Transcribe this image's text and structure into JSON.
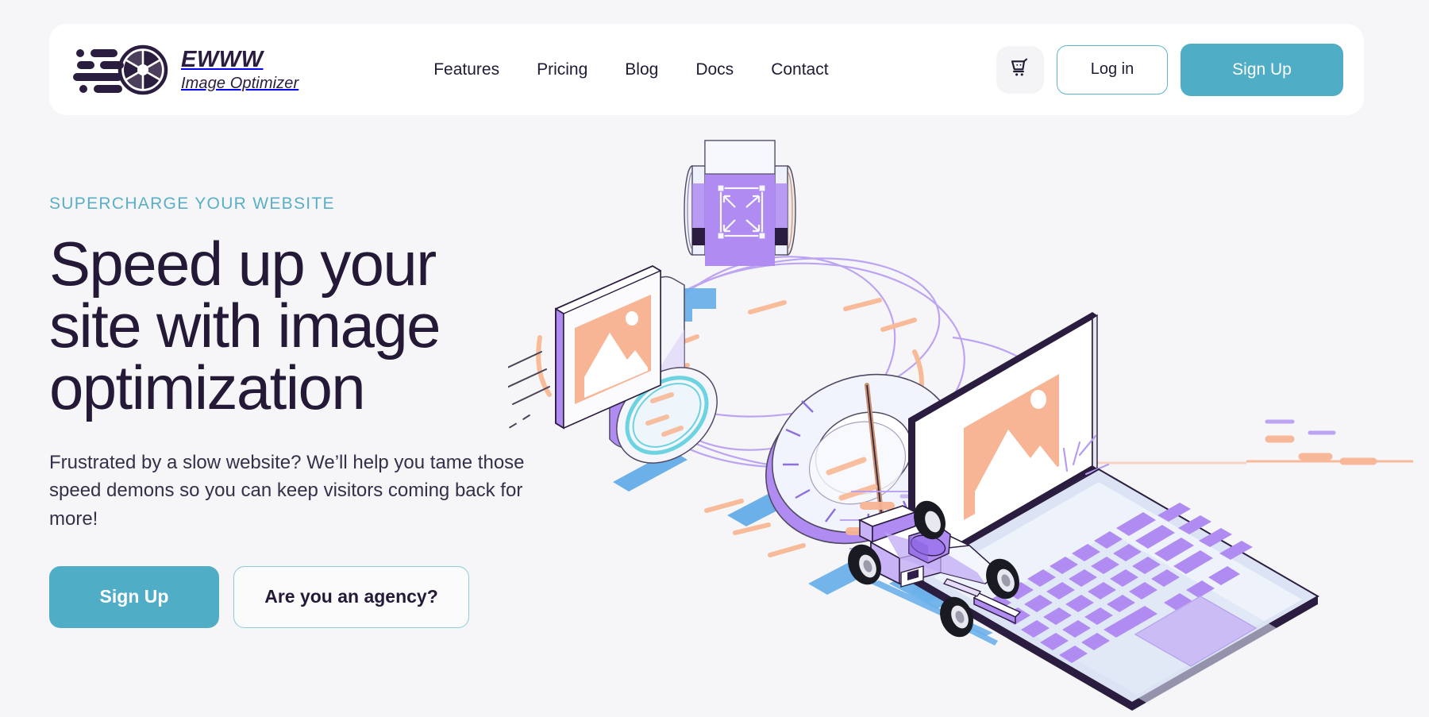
{
  "brand": {
    "name": "EWWW",
    "tagline": "Image Optimizer",
    "logo_icon": "camera-aperture-speed-icon"
  },
  "nav": {
    "links": [
      {
        "label": "Features"
      },
      {
        "label": "Pricing"
      },
      {
        "label": "Blog"
      },
      {
        "label": "Docs"
      },
      {
        "label": "Contact"
      }
    ],
    "cart_icon": "shopping-cart-icon",
    "login_label": "Log in",
    "signup_label": "Sign Up"
  },
  "hero": {
    "eyebrow": "SUPERCHARGE YOUR WEBSITE",
    "title": "Speed up your site with image optimization",
    "subtitle": "Frustrated by a slow website? We’ll help you tame those speed demons so you can keep visitors coming back for more!",
    "primary_cta": "Sign Up",
    "secondary_cta": "Are you an agency?",
    "illustration": "isometric-image-optimization-scene"
  },
  "colors": {
    "page_background": "#f6f6f8",
    "card_background": "#ffffff",
    "accent_teal": "#4fadc6",
    "eyebrow_teal": "#5aaec6",
    "heading_purple": "#241a38",
    "body_text": "#34304a",
    "illustration_purple": "#a78bf0",
    "illustration_lavender": "#c9b3f7",
    "illustration_peach": "#f8b595",
    "illustration_blue": "#6cb0ea",
    "illustration_outline": "#2b1d3f"
  }
}
